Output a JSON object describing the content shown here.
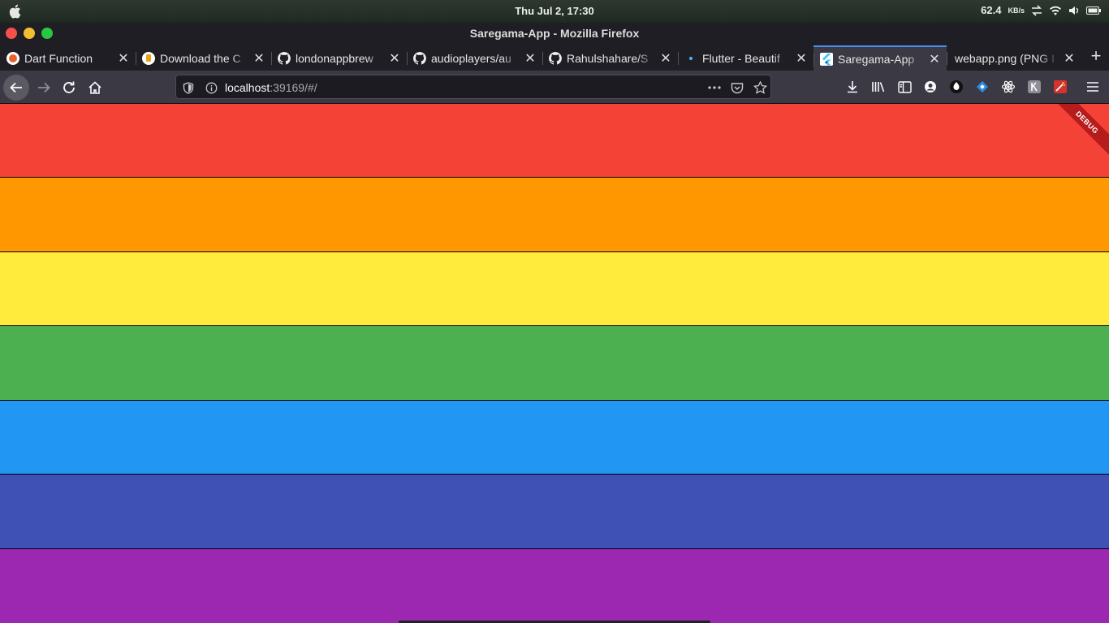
{
  "system_bar": {
    "clock": "Thu Jul  2, 17:30",
    "net_speed": "62.4",
    "net_unit": "KB/s"
  },
  "window": {
    "title": "Saregama-App - Mozilla Firefox"
  },
  "tabs": [
    {
      "label": "Dart Function",
      "icon": "dart-icon"
    },
    {
      "label": "Download the C",
      "icon": "beer-icon"
    },
    {
      "label": "londonappbrew",
      "icon": "github-icon"
    },
    {
      "label": "audioplayers/au",
      "icon": "github-icon"
    },
    {
      "label": "Rahulshahare/S",
      "icon": "github-icon"
    },
    {
      "label": "Flutter - Beautif",
      "icon": "flutter-dot-icon"
    },
    {
      "label": "Saregama-App",
      "icon": "flutter-icon",
      "active": true
    },
    {
      "label": "webapp.png (PNG I",
      "icon": "none"
    }
  ],
  "address_bar": {
    "host": "localhost",
    "rest": ":39169/#/"
  },
  "app": {
    "debug_banner": "DEBUG",
    "stripes": [
      {
        "color": "#f44336"
      },
      {
        "color": "#ff9800"
      },
      {
        "color": "#ffeb3b"
      },
      {
        "color": "#4caf50"
      },
      {
        "color": "#2196f3"
      },
      {
        "color": "#3f51b5"
      },
      {
        "color": "#9c27b0"
      }
    ]
  }
}
